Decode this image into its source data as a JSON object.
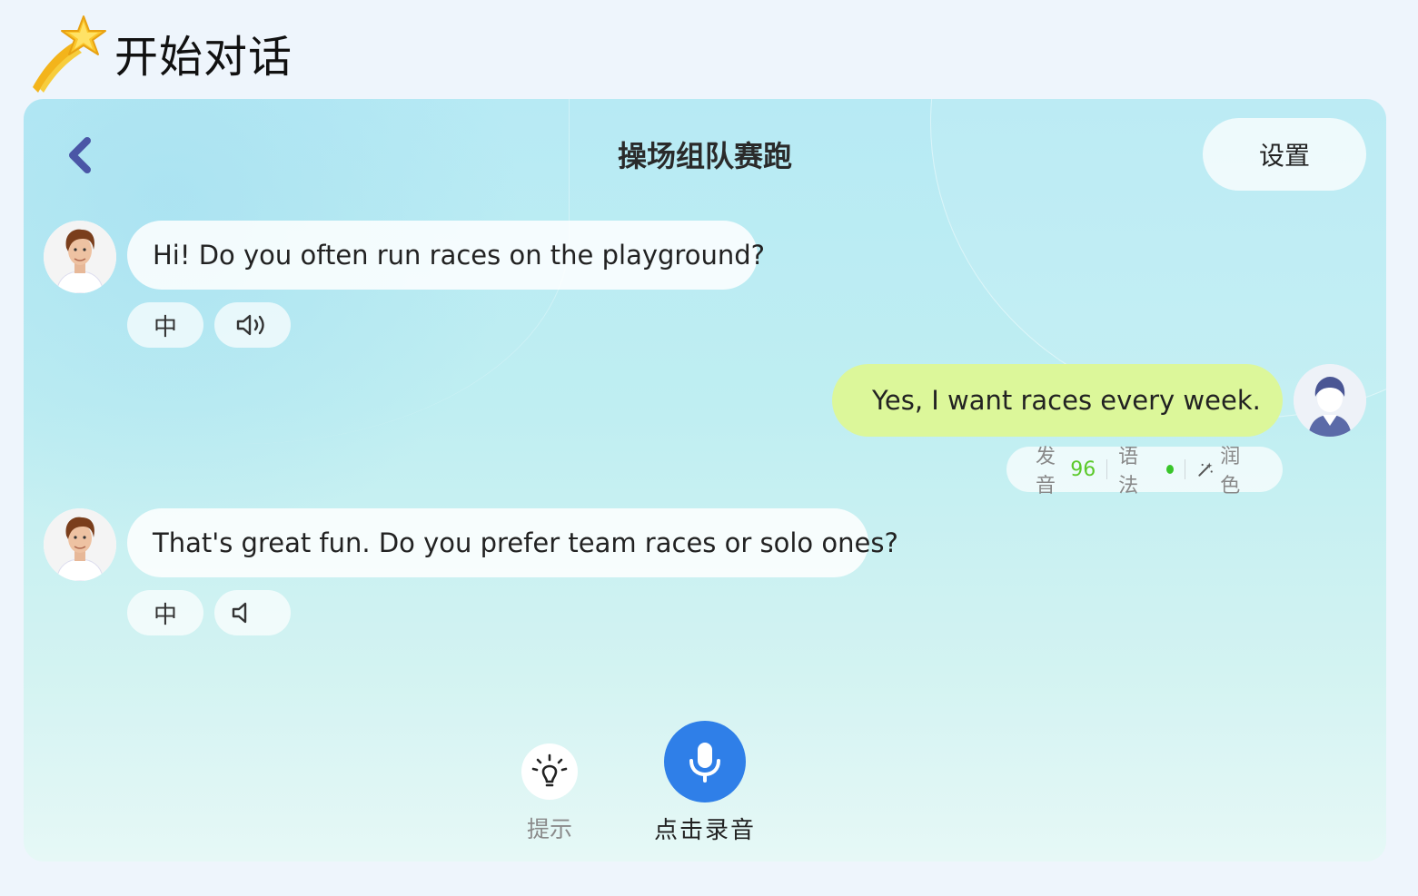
{
  "header": {
    "title": "开始对话",
    "icon": "shooting-star-icon"
  },
  "chat": {
    "scene_title": "操场组队赛跑",
    "settings_label": "设置",
    "back_icon": "chevron-left-icon",
    "messages": [
      {
        "role": "bot",
        "text": "Hi!  Do you often run races on the playground?",
        "translate_label": "中",
        "audio_icon": "speaker-playing-icon"
      },
      {
        "role": "user",
        "text": "Yes, I want races every week.",
        "audio_icon": "speaker-playing-icon",
        "scores": {
          "pronunciation_label": "发音",
          "pronunciation_score": "96",
          "grammar_label": "语法",
          "polish_label": "润色"
        }
      },
      {
        "role": "bot",
        "text": "That's great fun. Do you prefer team races or solo ones?",
        "translate_label": "中",
        "audio_icon": "speaker-icon"
      }
    ]
  },
  "controls": {
    "hint_label": "提示",
    "record_label": "点击录音",
    "hint_icon": "lightbulb-icon",
    "record_icon": "microphone-icon"
  },
  "colors": {
    "accent": "#2f7fe8",
    "user_bubble": "#dcf79a",
    "score_green": "#5cc92b",
    "back_arrow": "#4a56a6"
  }
}
